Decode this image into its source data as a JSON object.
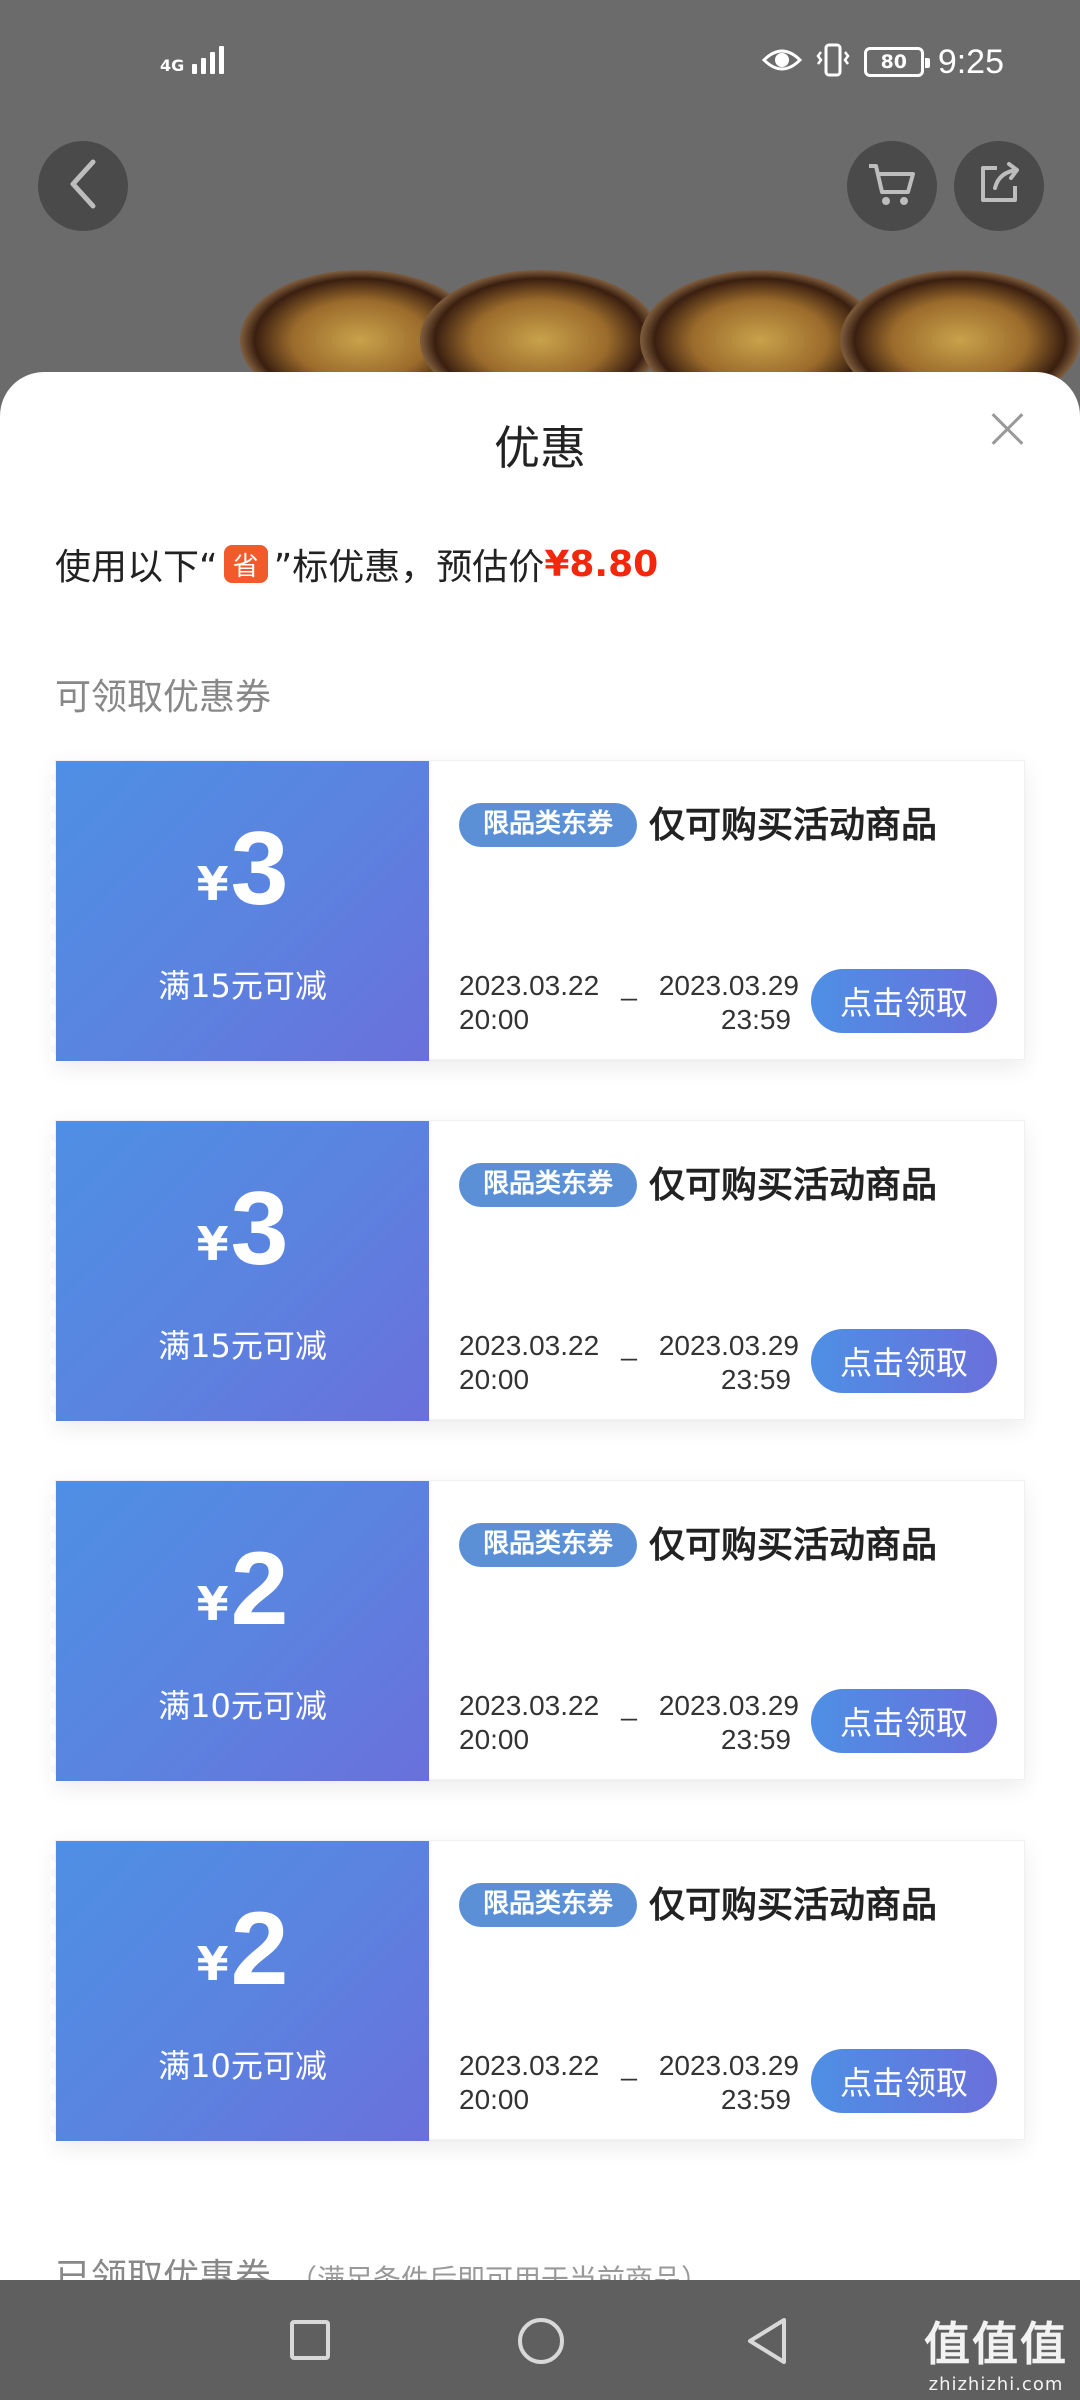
{
  "status_bar": {
    "network": "4G",
    "battery": "80",
    "time": "9:25"
  },
  "icons": {
    "back": "back-arrow-icon",
    "cart": "cart-icon",
    "share": "share-icon",
    "eye": "eye-icon",
    "vibrate": "vibrate-icon",
    "close": "close-icon"
  },
  "sheet": {
    "title": "优惠",
    "estimate": {
      "prefix": "使用以下“",
      "badge": "省",
      "suffix": "”标优惠，预估价",
      "price": "¥8.80"
    },
    "available_title": "可领取优惠券",
    "coupons": [
      {
        "currency": "¥",
        "amount": "3",
        "condition": "满15元可减",
        "tag": "限品类东券",
        "desc": "仅可购买活动商品",
        "start_date": "2023.03.22",
        "start_time": "20:00",
        "end_date": "2023.03.29",
        "end_time": "23:59",
        "separator": "_",
        "button": "点击领取"
      },
      {
        "currency": "¥",
        "amount": "3",
        "condition": "满15元可减",
        "tag": "限品类东券",
        "desc": "仅可购买活动商品",
        "start_date": "2023.03.22",
        "start_time": "20:00",
        "end_date": "2023.03.29",
        "end_time": "23:59",
        "separator": "_",
        "button": "点击领取"
      },
      {
        "currency": "¥",
        "amount": "2",
        "condition": "满10元可减",
        "tag": "限品类东券",
        "desc": "仅可购买活动商品",
        "start_date": "2023.03.22",
        "start_time": "20:00",
        "end_date": "2023.03.29",
        "end_time": "23:59",
        "separator": "_",
        "button": "点击领取"
      },
      {
        "currency": "¥",
        "amount": "2",
        "condition": "满10元可减",
        "tag": "限品类东券",
        "desc": "仅可购买活动商品",
        "start_date": "2023.03.22",
        "start_time": "20:00",
        "end_date": "2023.03.29",
        "end_time": "23:59",
        "separator": "_",
        "button": "点击领取"
      }
    ],
    "claimed_title": "已领取优惠券",
    "claimed_note": "（满足条件后即可用于当前商品）"
  },
  "watermark": {
    "main": "值值值",
    "sub": "zhizhizhi.com"
  },
  "colors": {
    "price_red": "#f2270c",
    "coupon_blue": "#4e8fe4",
    "coupon_purple": "#6a70db",
    "badge_orange": "#f25a2b"
  }
}
